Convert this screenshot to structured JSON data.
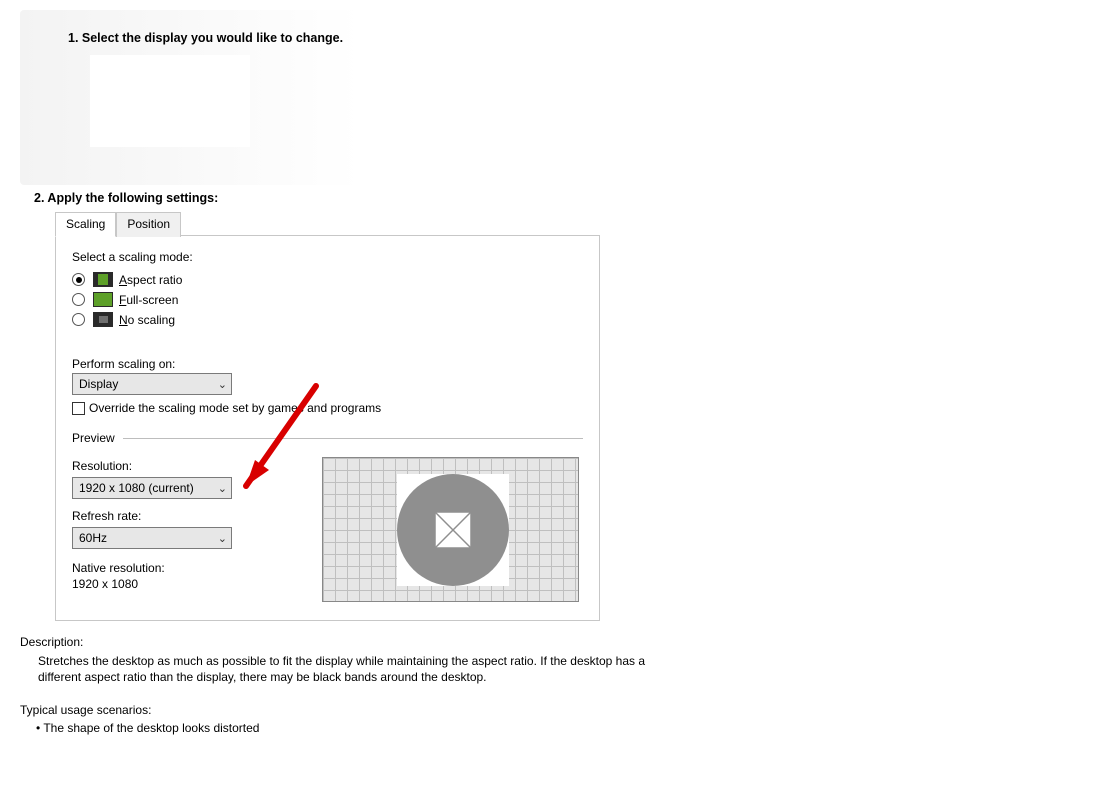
{
  "step1": {
    "title": "1. Select the display you would like to change."
  },
  "step2": {
    "title": "2. Apply the following settings:"
  },
  "tabs": {
    "scaling": "Scaling",
    "position": "Position"
  },
  "scaling_mode": {
    "label": "Select a scaling mode:",
    "aspect_prefix": "A",
    "aspect_rest": "spect ratio",
    "full_prefix": "F",
    "full_rest": "ull-screen",
    "noscale_prefix": "N",
    "noscale_rest": "o scaling"
  },
  "perform": {
    "label": "Perform scaling on:",
    "value": "Display",
    "override_text": "Override the scaling mode set by games and programs"
  },
  "preview": {
    "label": "Preview"
  },
  "resolution": {
    "label": "Resolution:",
    "value": "1920 x 1080 (current)"
  },
  "refresh": {
    "label": "Refresh rate:",
    "value": "60Hz"
  },
  "native": {
    "label": "Native resolution:",
    "value": "1920 x 1080"
  },
  "description": {
    "title": "Description:",
    "text": "Stretches the desktop as much as possible to fit the display while maintaining the aspect ratio. If the desktop has a different aspect ratio than the display, there may be black bands around the desktop."
  },
  "scenarios": {
    "title": "Typical usage scenarios:",
    "item1": "The shape of the desktop looks distorted"
  }
}
